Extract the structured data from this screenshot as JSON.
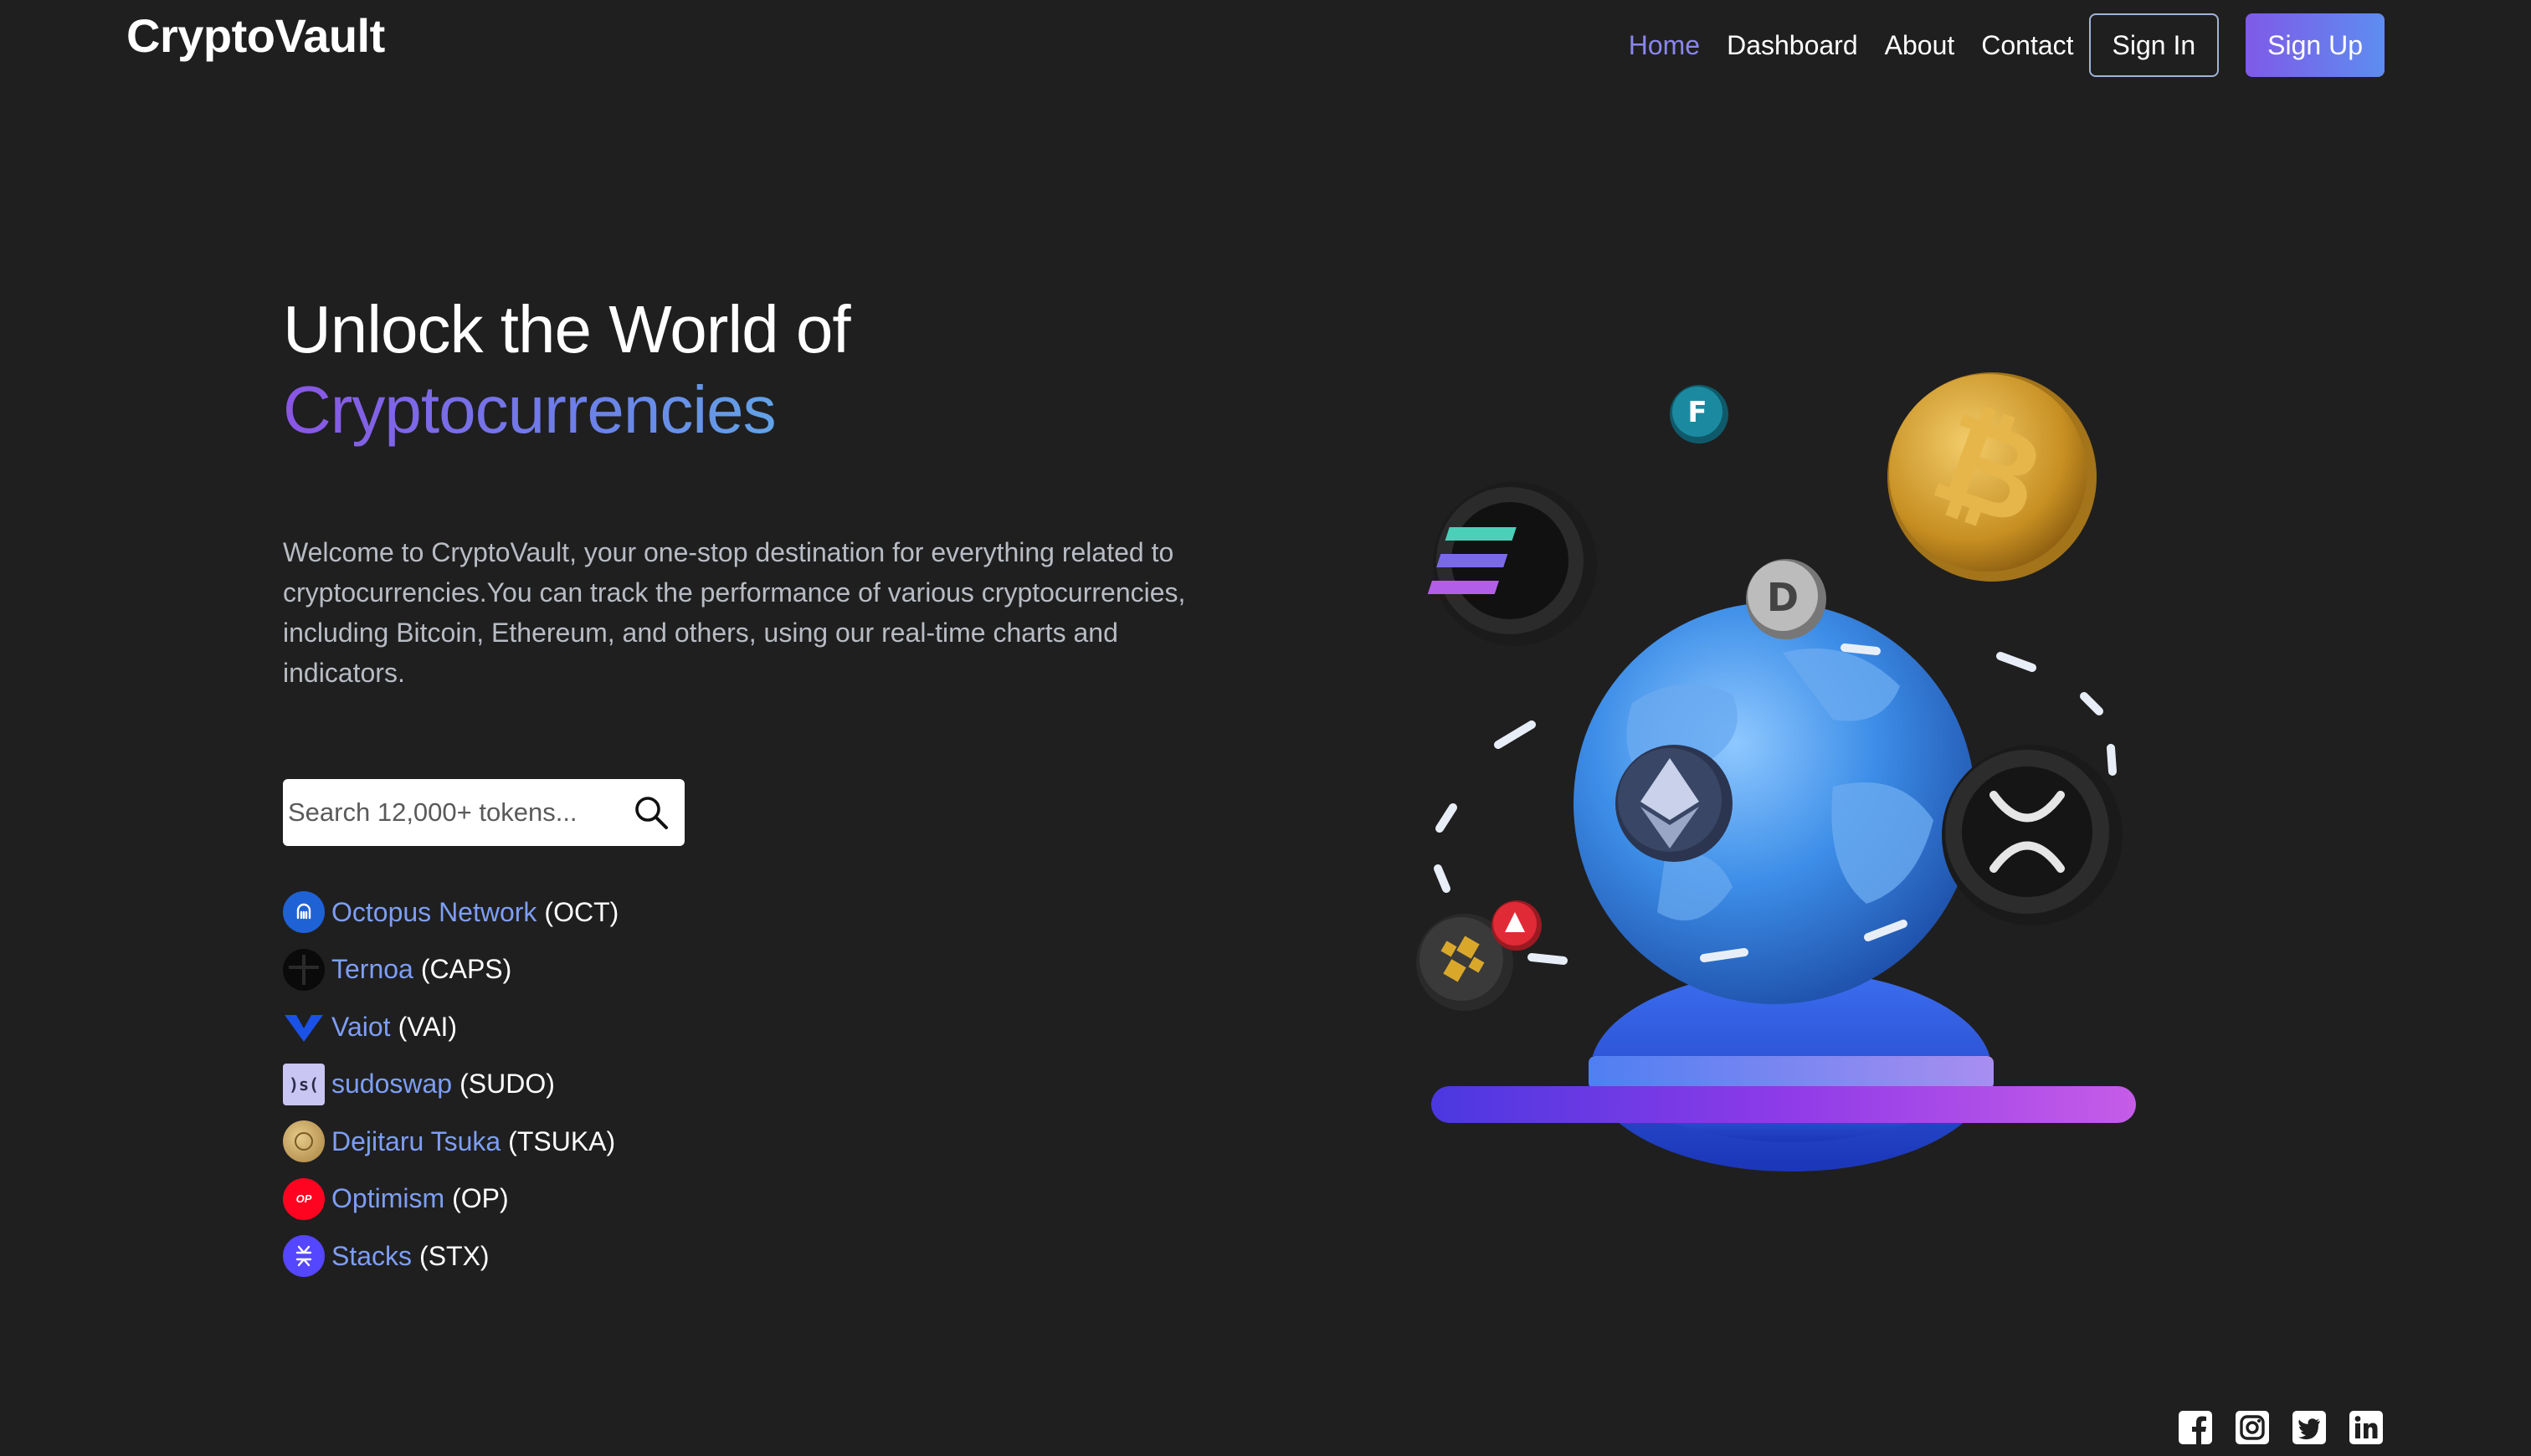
{
  "brand": "CryptoVault",
  "nav": {
    "links": [
      "Home",
      "Dashboard",
      "About",
      "Contact"
    ],
    "active": "Home",
    "signin_label": "Sign In",
    "signup_label": "Sign Up"
  },
  "hero": {
    "title_line1": "Unlock the World of",
    "title_line2": "Cryptocurrencies",
    "description": "Welcome to CryptoVault, your one-stop destination for everything related to cryptocurrencies.You can track the performance of various cryptocurrencies, including Bitcoin, Ethereum, and others, using our real-time charts and indicators."
  },
  "search": {
    "placeholder": "Search 12,000+ tokens..."
  },
  "tokens": [
    {
      "name": "Octopus Network",
      "symbol": "(OCT)",
      "icon": "octopus-network-icon",
      "color": "#1e62d6"
    },
    {
      "name": "Ternoa",
      "symbol": "(CAPS)",
      "icon": "ternoa-icon",
      "color": "#0a0a0a"
    },
    {
      "name": "Vaiot",
      "symbol": "(VAI)",
      "icon": "vaiot-icon",
      "color": "#1a52e8"
    },
    {
      "name": "sudoswap",
      "symbol": "(SUDO)",
      "icon": "sudoswap-icon",
      "color": "#c9c6f3"
    },
    {
      "name": "Dejitaru Tsuka",
      "symbol": "(TSUKA)",
      "icon": "dejitaru-tsuka-icon",
      "color": "#c8a35a"
    },
    {
      "name": "Optimism",
      "symbol": "(OP)",
      "icon": "optimism-icon",
      "color": "#ff0420"
    },
    {
      "name": "Stacks",
      "symbol": "(STX)",
      "icon": "stacks-icon",
      "color": "#5546ff"
    }
  ],
  "social": [
    "facebook-icon",
    "instagram-icon",
    "twitter-icon",
    "linkedin-icon"
  ],
  "colors": {
    "background": "#1f1f1f",
    "accent": "#8a86ee",
    "link": "#7d9ef5"
  }
}
